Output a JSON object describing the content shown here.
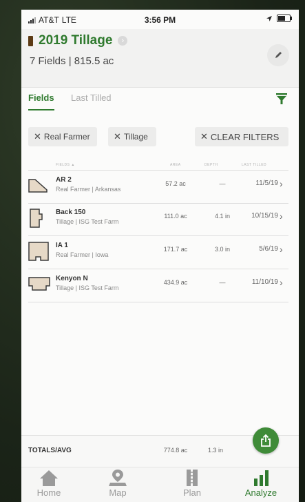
{
  "status_bar": {
    "carrier": "AT&T",
    "network": "LTE",
    "time": "3:56 PM"
  },
  "header": {
    "title": "2019 Tillage",
    "subtitle": "7 Fields | 815.5 ac"
  },
  "tabs": [
    {
      "label": "Fields",
      "active": true
    },
    {
      "label": "Last Tilled",
      "active": false
    }
  ],
  "filters": {
    "chips": [
      "Real Farmer",
      "Tillage"
    ],
    "clear_label": "CLEAR FILTERS"
  },
  "table": {
    "columns": [
      "FIELDS",
      "AREA",
      "DEPTH",
      "LAST TILLED"
    ],
    "rows": [
      {
        "name": "AR 2",
        "meta": "Real Farmer | Arkansas",
        "area": "57.2 ac",
        "depth": "—",
        "date": "11/5/19",
        "icon": "field-shape-ar2-icon"
      },
      {
        "name": "Back 150",
        "meta": "Tillage | ISG Test Farm",
        "area": "111.0 ac",
        "depth": "4.1 in",
        "date": "10/15/19",
        "icon": "field-shape-back150-icon"
      },
      {
        "name": "IA 1",
        "meta": "Real Farmer | Iowa",
        "area": "171.7 ac",
        "depth": "3.0 in",
        "date": "5/6/19",
        "icon": "field-shape-ia1-icon"
      },
      {
        "name": "Kenyon N",
        "meta": "Tillage | ISG Test Farm",
        "area": "434.9 ac",
        "depth": "—",
        "date": "11/10/19",
        "icon": "field-shape-kenyon-icon"
      }
    ]
  },
  "totals": {
    "label": "TOTALS/AVG",
    "area": "774.8 ac",
    "depth": "1.3 in"
  },
  "nav": [
    {
      "label": "Home",
      "icon": "home-icon",
      "active": false
    },
    {
      "label": "Map",
      "icon": "map-pin-icon",
      "active": false
    },
    {
      "label": "Plan",
      "icon": "plan-icon",
      "active": false
    },
    {
      "label": "Analyze",
      "icon": "bar-chart-icon",
      "active": true
    }
  ],
  "colors": {
    "accent": "#2f7a2e",
    "tag": "#5c3a14",
    "fab": "#3f8b38"
  }
}
